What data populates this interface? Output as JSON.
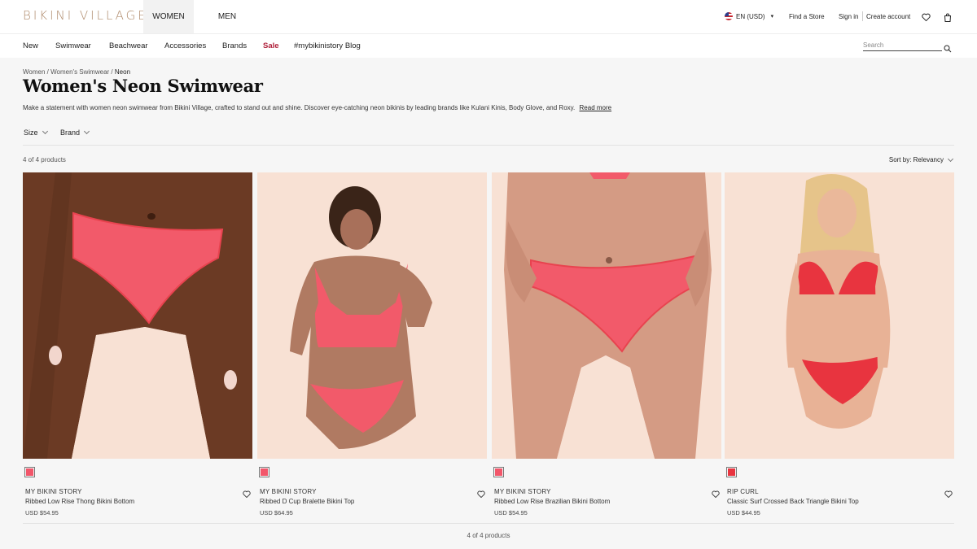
{
  "header": {
    "logo": "BIKINI VILLAGE",
    "gender_tabs": [
      {
        "label": "WOMEN",
        "active": true
      },
      {
        "label": "MEN",
        "active": false
      }
    ],
    "language": "EN (USD)",
    "find_store": "Find a Store",
    "sign_in": "Sign in",
    "create_account": "Create account",
    "icons": [
      "flag-us-icon",
      "heart-icon",
      "bag-icon"
    ]
  },
  "nav": {
    "items": [
      "New",
      "Swimwear",
      "Beachwear",
      "Accessories",
      "Brands",
      "Sale",
      "#mybikinistory Blog"
    ],
    "search_placeholder": "Search"
  },
  "breadcrumb": {
    "items": [
      "Women",
      "Women's Swimwear",
      "Neon"
    ],
    "separator": "/"
  },
  "page": {
    "title": "Women's Neon Swimwear",
    "description": "Make a statement with women neon swimwear from Bikini Village, crafted to stand out and shine. Discover eye-catching neon bikinis by leading brands like Kulani Kinis, Body Glove, and Roxy.",
    "read_more": "Read more"
  },
  "filters": [
    "Size",
    "Brand"
  ],
  "results": {
    "count_text": "4 of 4 products",
    "sort_label": "Sort by: Relevancy",
    "bottom_count_text": "4 of 4 products"
  },
  "products": [
    {
      "brand": "MY BIKINI STORY",
      "name": "Ribbed Low Rise Thong Bikini Bottom",
      "price": "USD $54.95",
      "swatch_color": "#f2566a"
    },
    {
      "brand": "MY BIKINI STORY",
      "name": "Ribbed D Cup Bralette Bikini Top",
      "price": "USD $64.95",
      "swatch_color": "#f2566a"
    },
    {
      "brand": "MY BIKINI STORY",
      "name": "Ribbed Low Rise Brazilian Bikini Bottom",
      "price": "USD $54.95",
      "swatch_color": "#f2566a"
    },
    {
      "brand": "RIP CURL",
      "name": "Classic Surf Crossed Back Triangle Bikini Top",
      "price": "USD $44.95",
      "swatch_color": "#e8343f"
    }
  ],
  "colors": {
    "logo": "#b08b6c",
    "sale": "#b0213b",
    "page_bg": "#f6f6f6",
    "photo_bg": "#f7ddd0",
    "swimwear_coral": "#f25a6a",
    "swimwear_red": "#e8343f"
  }
}
